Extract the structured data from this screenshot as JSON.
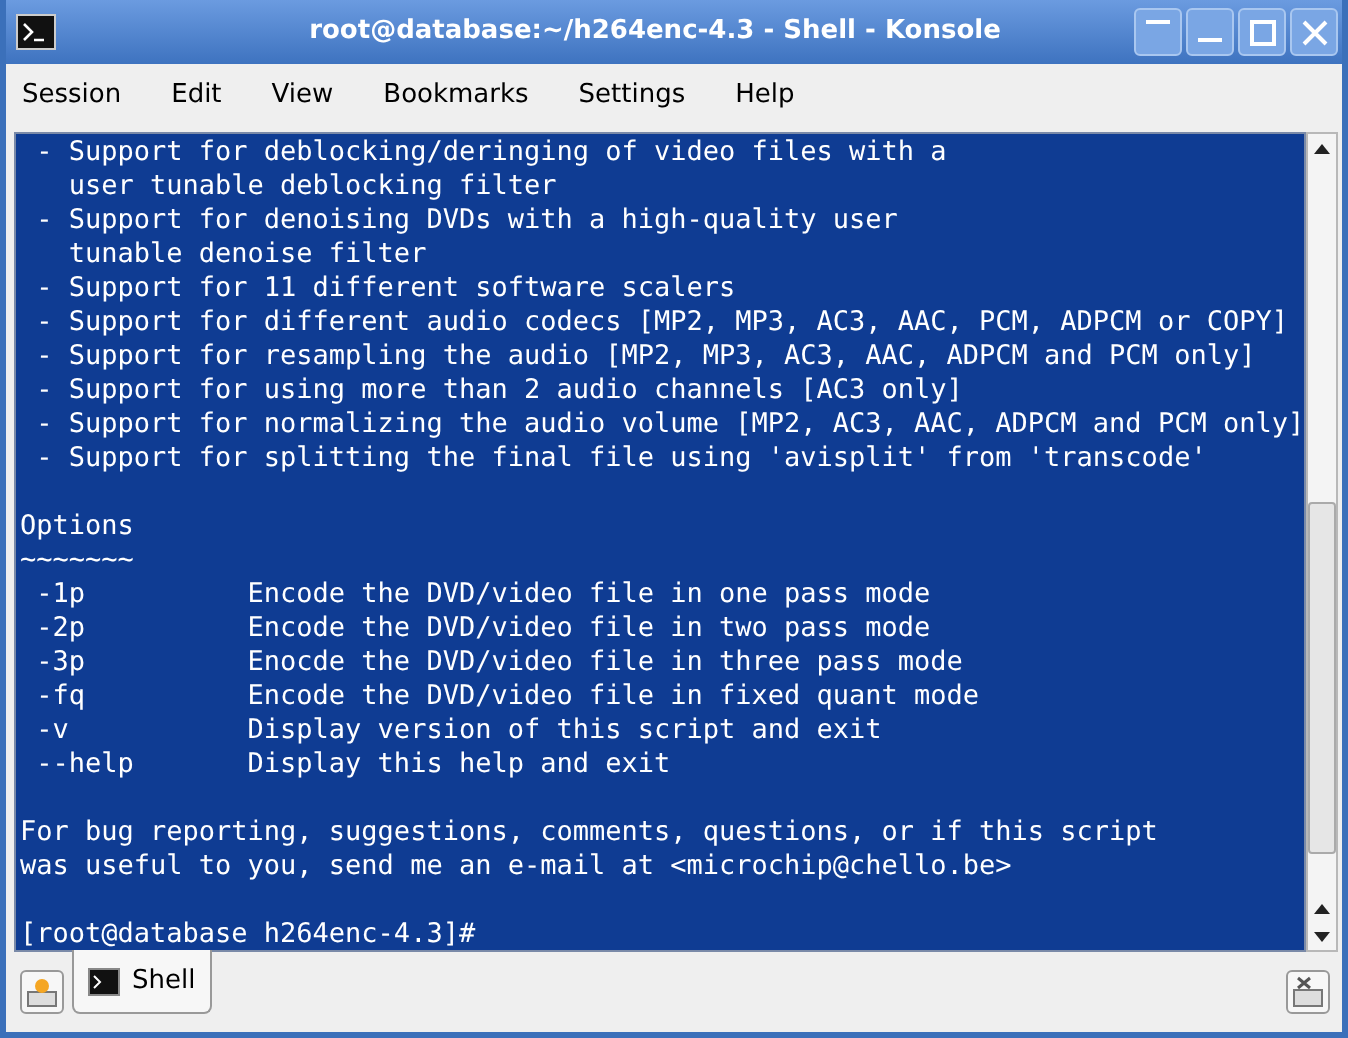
{
  "window": {
    "title": "root@database:~/h264enc-4.3 - Shell - Konsole"
  },
  "menu": [
    "Session",
    "Edit",
    "View",
    "Bookmarks",
    "Settings",
    "Help"
  ],
  "terminal": {
    "lines": [
      {
        "kind": "text",
        "text": " - Support for deblocking/deringing of video files with a"
      },
      {
        "kind": "text",
        "text": "   user tunable deblocking filter"
      },
      {
        "kind": "text",
        "text": " - Support for denoising DVDs with a high-quality user"
      },
      {
        "kind": "text",
        "text": "   tunable denoise filter"
      },
      {
        "kind": "text",
        "text": " - Support for 11 different software scalers"
      },
      {
        "kind": "text",
        "text": " - Support for different audio codecs [MP2, MP3, AC3, AAC, PCM, ADPCM or COPY]"
      },
      {
        "kind": "text",
        "text": " - Support for resampling the audio [MP2, MP3, AC3, AAC, ADPCM and PCM only]"
      },
      {
        "kind": "text",
        "text": " - Support for using more than 2 audio channels [AC3 only]"
      },
      {
        "kind": "text",
        "text": " - Support for normalizing the audio volume [MP2, AC3, AAC, ADPCM and PCM only]"
      },
      {
        "kind": "text",
        "text": " - Support for splitting the final file using 'avisplit' from 'transcode'"
      },
      {
        "kind": "blank"
      },
      {
        "kind": "text",
        "text": "Options"
      },
      {
        "kind": "text",
        "text": "~~~~~~~"
      },
      {
        "kind": "text",
        "text": " -1p          Encode the DVD/video file in one pass mode"
      },
      {
        "kind": "text",
        "text": " -2p          Encode the DVD/video file in two pass mode"
      },
      {
        "kind": "text",
        "text": " -3p          Enocde the DVD/video file in three pass mode"
      },
      {
        "kind": "text",
        "text": " -fq          Encode the DVD/video file in fixed quant mode"
      },
      {
        "kind": "text",
        "text": " -v           Display version of this script and exit"
      },
      {
        "kind": "text",
        "text": " --help       Display this help and exit"
      },
      {
        "kind": "blank"
      },
      {
        "kind": "text",
        "text": "For bug reporting, suggestions, comments, questions, or if this script"
      },
      {
        "kind": "text",
        "text": "was useful to you, send me an e-mail at <microchip@chello.be>"
      },
      {
        "kind": "blank"
      },
      {
        "kind": "text",
        "text": "[root@database h264enc-4.3]#"
      }
    ]
  },
  "tabs": [
    {
      "label": "Shell",
      "selected": true
    }
  ]
}
